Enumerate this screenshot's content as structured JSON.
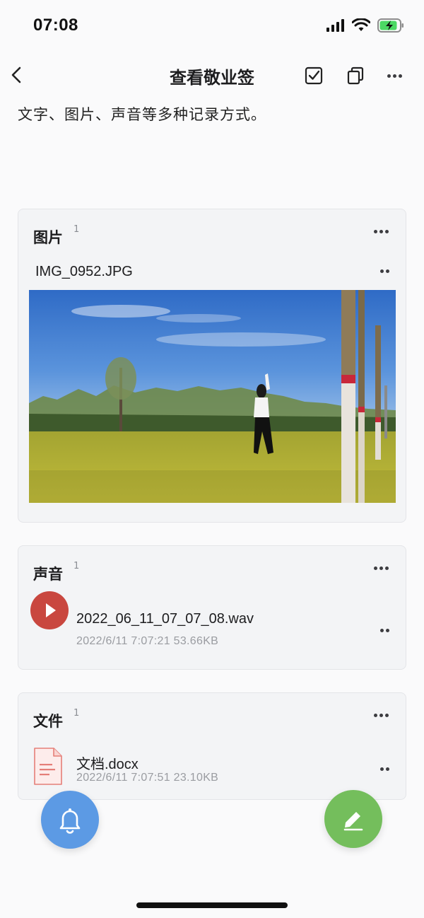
{
  "status": {
    "time": "07:08",
    "icons": [
      "signal-icon",
      "wifi-icon",
      "battery-charging-icon"
    ]
  },
  "nav": {
    "title": "查看敬业签",
    "actions": [
      "back-icon",
      "checkbox-icon",
      "copy-icon",
      "more-icon"
    ]
  },
  "content": {
    "intro": "文字、图片、声音等多种记录方式。"
  },
  "image_card": {
    "title": "图片",
    "count": "1",
    "file_name": "IMG_0952.JPG"
  },
  "audio_card": {
    "title": "声音",
    "count": "1",
    "file_name": "2022_06_11_07_07_08.wav",
    "meta": "2022/6/11 7:07:21  53.66KB"
  },
  "file_card": {
    "title": "文件",
    "count": "1",
    "file_name": "文档.docx",
    "meta": "2022/6/11 7:07:51  23.10KB"
  },
  "fabs": {
    "left": "bell-icon",
    "right": "edit-icon"
  },
  "colors": {
    "play_button": "#c9473f",
    "bell_fab": "#5c9ae4",
    "edit_fab": "#74be5c",
    "card_bg": "#f3f4f6"
  }
}
